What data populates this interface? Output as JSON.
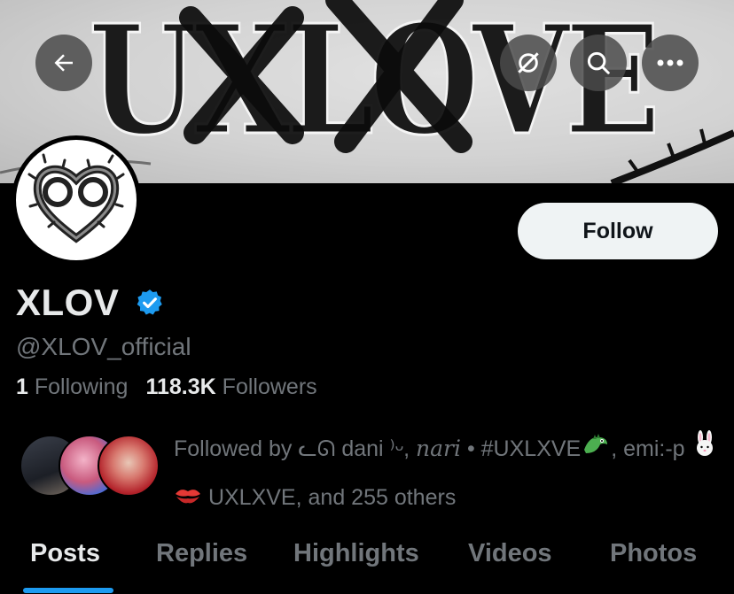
{
  "banner": {
    "text": "UXLOVE",
    "icons": [
      "back-arrow-icon",
      "no-notifications-icon",
      "search-icon",
      "more-icon"
    ]
  },
  "profile": {
    "display_name": "XLOV",
    "verified": true,
    "handle": "@XLOV_official",
    "following_count": "1",
    "following_label": "Following",
    "followers_count": "118.3K",
    "followers_label": "Followers"
  },
  "follow_button": {
    "label": "Follow"
  },
  "followed_by": {
    "prefix": "Followed by",
    "user1": "ᓚᘏ dani ⁾ᵕ,",
    "user2": "𝑛𝑎𝑟𝑖",
    "sep": "•",
    "user3": "#UXLXVE",
    "user4": ", emi:-p",
    "user5": "UXLXVE",
    "suffix": ", and 255 others"
  },
  "tabs": [
    "Posts",
    "Replies",
    "Highlights",
    "Videos",
    "Photos"
  ],
  "active_tab": "Posts",
  "colors": {
    "accent": "#1d9bf0",
    "background": "#000000",
    "secondary_text": "#71767b",
    "primary_text": "#e7e9ea",
    "follow_bg": "#eff3f4"
  }
}
